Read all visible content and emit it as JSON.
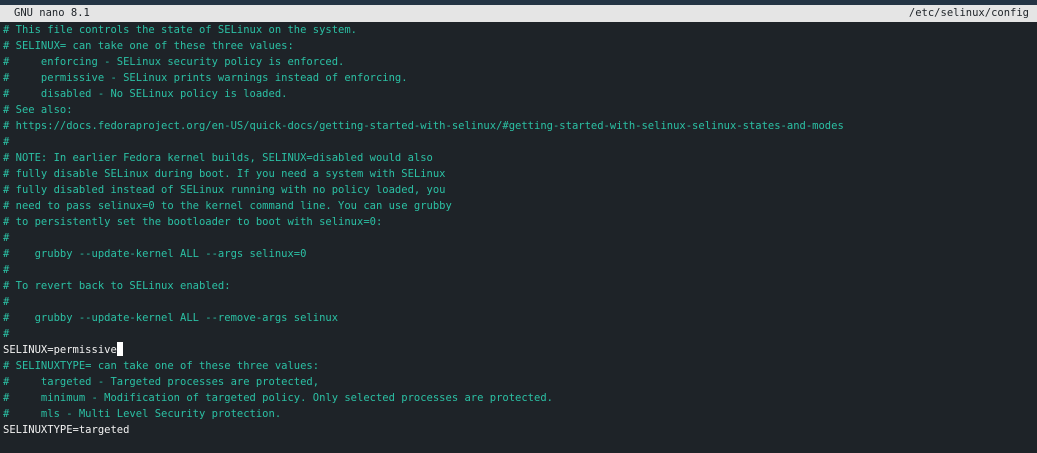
{
  "titlebar": {
    "app_version": "GNU nano 8.1",
    "file_path": "/etc/selinux/config"
  },
  "lines": [
    {
      "kind": "comment",
      "text": "# This file controls the state of SELinux on the system."
    },
    {
      "kind": "comment",
      "text": "# SELINUX= can take one of these three values:"
    },
    {
      "kind": "comment",
      "text": "#     enforcing - SELinux security policy is enforced."
    },
    {
      "kind": "comment",
      "text": "#     permissive - SELinux prints warnings instead of enforcing."
    },
    {
      "kind": "comment",
      "text": "#     disabled - No SELinux policy is loaded."
    },
    {
      "kind": "comment",
      "text": "# See also:"
    },
    {
      "kind": "comment",
      "text": "# https://docs.fedoraproject.org/en-US/quick-docs/getting-started-with-selinux/#getting-started-with-selinux-selinux-states-and-modes"
    },
    {
      "kind": "comment",
      "text": "#"
    },
    {
      "kind": "comment",
      "text": "# NOTE: In earlier Fedora kernel builds, SELINUX=disabled would also"
    },
    {
      "kind": "comment",
      "text": "# fully disable SELinux during boot. If you need a system with SELinux"
    },
    {
      "kind": "comment",
      "text": "# fully disabled instead of SELinux running with no policy loaded, you"
    },
    {
      "kind": "comment",
      "text": "# need to pass selinux=0 to the kernel command line. You can use grubby"
    },
    {
      "kind": "comment",
      "text": "# to persistently set the bootloader to boot with selinux=0:"
    },
    {
      "kind": "comment",
      "text": "#"
    },
    {
      "kind": "comment",
      "text": "#    grubby --update-kernel ALL --args selinux=0"
    },
    {
      "kind": "comment",
      "text": "#"
    },
    {
      "kind": "comment",
      "text": "# To revert back to SELinux enabled:"
    },
    {
      "kind": "comment",
      "text": "#"
    },
    {
      "kind": "comment",
      "text": "#    grubby --update-kernel ALL --remove-args selinux"
    },
    {
      "kind": "comment",
      "text": "#"
    },
    {
      "kind": "setting",
      "text": "SELINUX=permissive",
      "cursor": true
    },
    {
      "kind": "comment",
      "text": "# SELINUXTYPE= can take one of these three values:"
    },
    {
      "kind": "comment",
      "text": "#     targeted - Targeted processes are protected,"
    },
    {
      "kind": "comment",
      "text": "#     minimum - Modification of targeted policy. Only selected processes are protected."
    },
    {
      "kind": "comment",
      "text": "#     mls - Multi Level Security protection."
    },
    {
      "kind": "setting",
      "text": "SELINUXTYPE=targeted"
    }
  ],
  "colors": {
    "background": "#1e2328",
    "titlebar_bg": "#e5e5e5",
    "comment": "#2bc0a4",
    "setting": "#f2f2f2"
  }
}
